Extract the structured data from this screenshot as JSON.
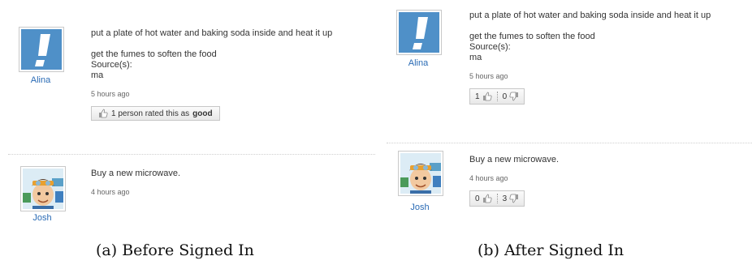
{
  "panel_a": {
    "answers": [
      {
        "author": "Alina",
        "lines": [
          "put a plate of hot water and baking soda inside and heat it up",
          "get the fumes to soften the food"
        ],
        "source_label": "Source(s):",
        "source_value": "ma",
        "time": "5 hours ago",
        "rating_prefix": "1 person rated this as",
        "rating_word": "good"
      },
      {
        "author": "Josh",
        "lines": [
          "Buy a new microwave."
        ],
        "time": "4 hours ago"
      }
    ],
    "caption": "(a) Before Signed In"
  },
  "panel_b": {
    "answers": [
      {
        "author": "Alina",
        "lines": [
          "put a plate of hot water and baking soda inside and heat it up",
          "get the fumes to soften the food"
        ],
        "source_label": "Source(s):",
        "source_value": "ma",
        "time": "5 hours ago",
        "thumbs_up": "1",
        "thumbs_down": "0"
      },
      {
        "author": "Josh",
        "lines": [
          "Buy a new microwave."
        ],
        "time": "4 hours ago",
        "thumbs_up": "0",
        "thumbs_down": "3"
      }
    ],
    "caption": "(b) After Signed In"
  },
  "icons": {
    "alina_avatar": "exclamation-avatar-icon",
    "josh_avatar": "cartoon-boy-avatar-icon",
    "thumbs_up": "thumbs-up-icon",
    "thumbs_down": "thumbs-down-icon"
  },
  "colors": {
    "author_link": "#2a6bb5",
    "alina_avatar_bg": "#4f90c8"
  }
}
